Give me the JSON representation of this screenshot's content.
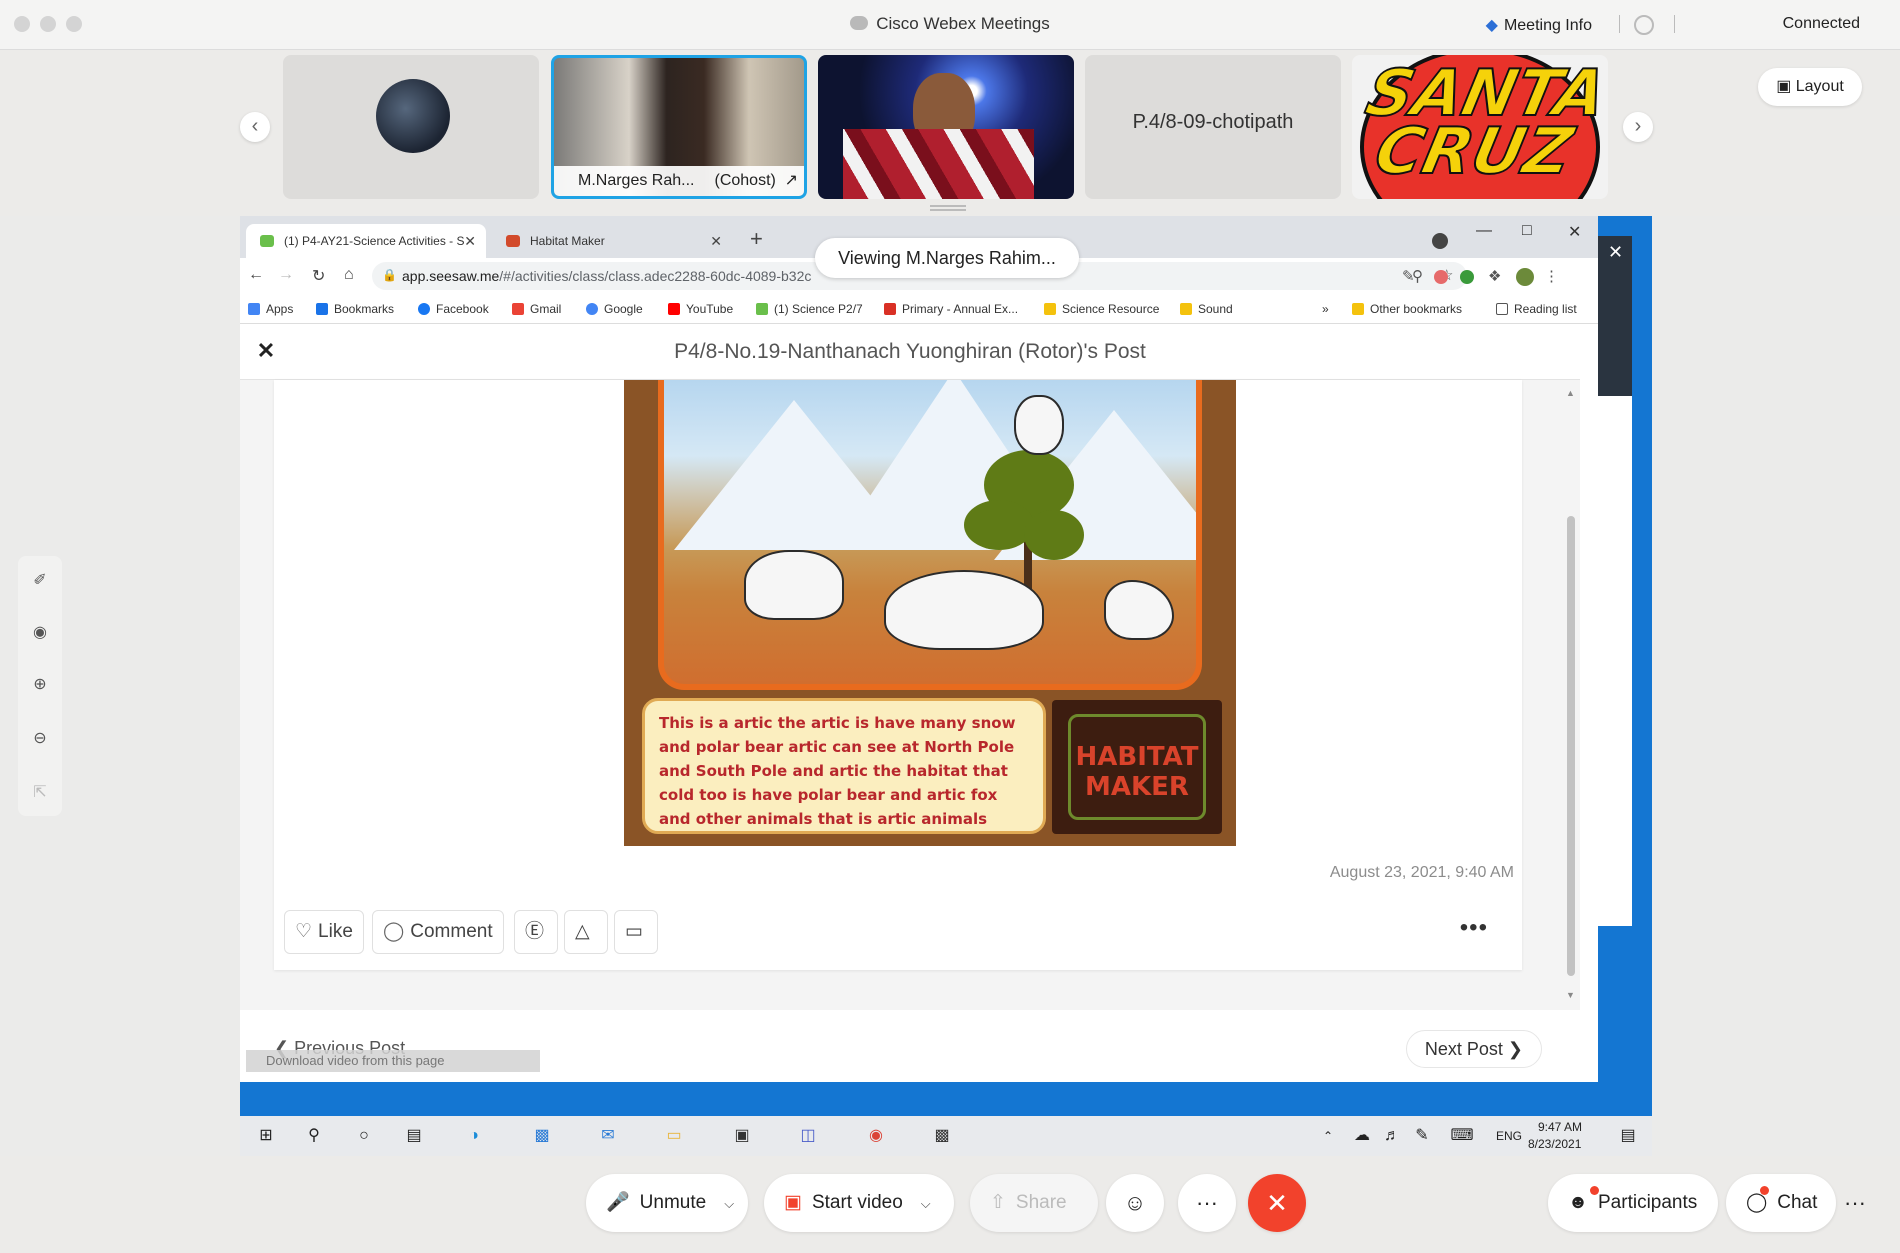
{
  "app": {
    "title": "Cisco Webex Meetings",
    "meeting_info": "Meeting Info",
    "status": "Connected"
  },
  "participants": {
    "tiles": [
      {
        "name": "",
        "type": "avatar"
      },
      {
        "name": "M.Narges Rah...",
        "role": "(Cohost)",
        "type": "video",
        "active": true
      },
      {
        "name": "",
        "type": "video"
      },
      {
        "name": "P.4/8-09-chotipath",
        "type": "name"
      },
      {
        "name": "",
        "type": "logo",
        "logo_text": "SANTA CRUZ"
      }
    ],
    "layout_label": "Layout"
  },
  "viewing": "Viewing M.Narges Rahim...",
  "browser": {
    "tabs": [
      {
        "label": "(1) P4-AY21-Science Activities - S",
        "active": true
      },
      {
        "label": "Habitat Maker",
        "active": false
      }
    ],
    "url_main": "app.seesaw.me",
    "url_rest": "/#/activities/class/class.adec2288-60dc-4089-b32c",
    "bookmarks": [
      {
        "label": "Apps",
        "color": "#4285f4"
      },
      {
        "label": "Bookmarks",
        "color": "#1a73e8"
      },
      {
        "label": "Facebook",
        "color": "#1877f2"
      },
      {
        "label": "Gmail",
        "color": "#ea4335"
      },
      {
        "label": "Google",
        "color": "#4285f4"
      },
      {
        "label": "YouTube",
        "color": "#ff0000"
      },
      {
        "label": "(1) Science P2/7",
        "color": "#6abf4b"
      },
      {
        "label": "Primary - Annual Ex...",
        "color": "#d93025"
      },
      {
        "label": "Science Resource",
        "color": "#f4c20d"
      },
      {
        "label": "Sound",
        "color": "#f4c20d"
      }
    ],
    "bookmarks_overflow": "»",
    "other_bookmarks": "Other bookmarks",
    "reading_list": "Reading list"
  },
  "post": {
    "title": "P4/8-No.19-Nanthanach Yuonghiran (Rotor)'s Post",
    "caption": "This is a artic the artic is have many snow and polar bear artic can see at North Pole and South Pole and artic the habitat that cold too is have polar bear and artic fox and other animals  that is artic animals",
    "logo_line1": "HABITAT",
    "logo_line2": "MAKER",
    "date": "August 23, 2021, 9:40 AM",
    "like_label": "Like",
    "comment_label": "Comment",
    "more": "•••",
    "prev_label": "Previous Post",
    "next_label": "Next Post",
    "download_overlay": "Download video from this page"
  },
  "taskbar": {
    "lang": "ENG",
    "time": "9:47 AM",
    "date": "8/23/2021"
  },
  "controls": {
    "unmute": "Unmute",
    "start_video": "Start video",
    "share": "Share",
    "more": "···",
    "participants": "Participants",
    "chat": "Chat",
    "end_color": "#f2422c"
  }
}
